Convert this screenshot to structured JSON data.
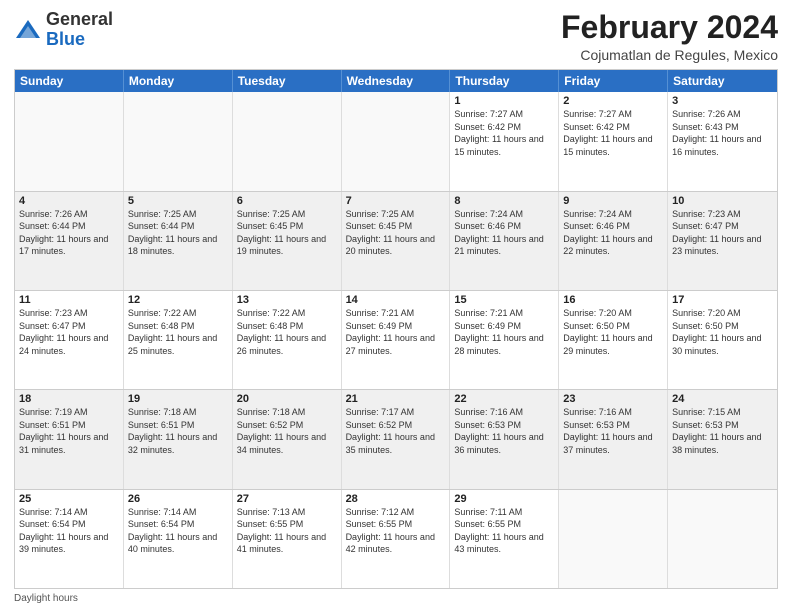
{
  "header": {
    "logo_general": "General",
    "logo_blue": "Blue",
    "main_title": "February 2024",
    "subtitle": "Cojumatlan de Regules, Mexico"
  },
  "calendar": {
    "days_of_week": [
      "Sunday",
      "Monday",
      "Tuesday",
      "Wednesday",
      "Thursday",
      "Friday",
      "Saturday"
    ],
    "rows": [
      {
        "cells": [
          {
            "day": "",
            "info": "",
            "empty": true
          },
          {
            "day": "",
            "info": "",
            "empty": true
          },
          {
            "day": "",
            "info": "",
            "empty": true
          },
          {
            "day": "",
            "info": "",
            "empty": true
          },
          {
            "day": "1",
            "info": "Sunrise: 7:27 AM\nSunset: 6:42 PM\nDaylight: 11 hours and 15 minutes."
          },
          {
            "day": "2",
            "info": "Sunrise: 7:27 AM\nSunset: 6:42 PM\nDaylight: 11 hours and 15 minutes."
          },
          {
            "day": "3",
            "info": "Sunrise: 7:26 AM\nSunset: 6:43 PM\nDaylight: 11 hours and 16 minutes."
          }
        ]
      },
      {
        "cells": [
          {
            "day": "4",
            "info": "Sunrise: 7:26 AM\nSunset: 6:44 PM\nDaylight: 11 hours and 17 minutes.",
            "shaded": true
          },
          {
            "day": "5",
            "info": "Sunrise: 7:25 AM\nSunset: 6:44 PM\nDaylight: 11 hours and 18 minutes.",
            "shaded": true
          },
          {
            "day": "6",
            "info": "Sunrise: 7:25 AM\nSunset: 6:45 PM\nDaylight: 11 hours and 19 minutes.",
            "shaded": true
          },
          {
            "day": "7",
            "info": "Sunrise: 7:25 AM\nSunset: 6:45 PM\nDaylight: 11 hours and 20 minutes.",
            "shaded": true
          },
          {
            "day": "8",
            "info": "Sunrise: 7:24 AM\nSunset: 6:46 PM\nDaylight: 11 hours and 21 minutes.",
            "shaded": true
          },
          {
            "day": "9",
            "info": "Sunrise: 7:24 AM\nSunset: 6:46 PM\nDaylight: 11 hours and 22 minutes.",
            "shaded": true
          },
          {
            "day": "10",
            "info": "Sunrise: 7:23 AM\nSunset: 6:47 PM\nDaylight: 11 hours and 23 minutes.",
            "shaded": true
          }
        ]
      },
      {
        "cells": [
          {
            "day": "11",
            "info": "Sunrise: 7:23 AM\nSunset: 6:47 PM\nDaylight: 11 hours and 24 minutes."
          },
          {
            "day": "12",
            "info": "Sunrise: 7:22 AM\nSunset: 6:48 PM\nDaylight: 11 hours and 25 minutes."
          },
          {
            "day": "13",
            "info": "Sunrise: 7:22 AM\nSunset: 6:48 PM\nDaylight: 11 hours and 26 minutes."
          },
          {
            "day": "14",
            "info": "Sunrise: 7:21 AM\nSunset: 6:49 PM\nDaylight: 11 hours and 27 minutes."
          },
          {
            "day": "15",
            "info": "Sunrise: 7:21 AM\nSunset: 6:49 PM\nDaylight: 11 hours and 28 minutes."
          },
          {
            "day": "16",
            "info": "Sunrise: 7:20 AM\nSunset: 6:50 PM\nDaylight: 11 hours and 29 minutes."
          },
          {
            "day": "17",
            "info": "Sunrise: 7:20 AM\nSunset: 6:50 PM\nDaylight: 11 hours and 30 minutes."
          }
        ]
      },
      {
        "cells": [
          {
            "day": "18",
            "info": "Sunrise: 7:19 AM\nSunset: 6:51 PM\nDaylight: 11 hours and 31 minutes.",
            "shaded": true
          },
          {
            "day": "19",
            "info": "Sunrise: 7:18 AM\nSunset: 6:51 PM\nDaylight: 11 hours and 32 minutes.",
            "shaded": true
          },
          {
            "day": "20",
            "info": "Sunrise: 7:18 AM\nSunset: 6:52 PM\nDaylight: 11 hours and 34 minutes.",
            "shaded": true
          },
          {
            "day": "21",
            "info": "Sunrise: 7:17 AM\nSunset: 6:52 PM\nDaylight: 11 hours and 35 minutes.",
            "shaded": true
          },
          {
            "day": "22",
            "info": "Sunrise: 7:16 AM\nSunset: 6:53 PM\nDaylight: 11 hours and 36 minutes.",
            "shaded": true
          },
          {
            "day": "23",
            "info": "Sunrise: 7:16 AM\nSunset: 6:53 PM\nDaylight: 11 hours and 37 minutes.",
            "shaded": true
          },
          {
            "day": "24",
            "info": "Sunrise: 7:15 AM\nSunset: 6:53 PM\nDaylight: 11 hours and 38 minutes.",
            "shaded": true
          }
        ]
      },
      {
        "cells": [
          {
            "day": "25",
            "info": "Sunrise: 7:14 AM\nSunset: 6:54 PM\nDaylight: 11 hours and 39 minutes."
          },
          {
            "day": "26",
            "info": "Sunrise: 7:14 AM\nSunset: 6:54 PM\nDaylight: 11 hours and 40 minutes."
          },
          {
            "day": "27",
            "info": "Sunrise: 7:13 AM\nSunset: 6:55 PM\nDaylight: 11 hours and 41 minutes."
          },
          {
            "day": "28",
            "info": "Sunrise: 7:12 AM\nSunset: 6:55 PM\nDaylight: 11 hours and 42 minutes."
          },
          {
            "day": "29",
            "info": "Sunrise: 7:11 AM\nSunset: 6:55 PM\nDaylight: 11 hours and 43 minutes."
          },
          {
            "day": "",
            "info": "",
            "empty": true
          },
          {
            "day": "",
            "info": "",
            "empty": true
          }
        ]
      }
    ]
  },
  "footer": {
    "daylight_label": "Daylight hours"
  }
}
